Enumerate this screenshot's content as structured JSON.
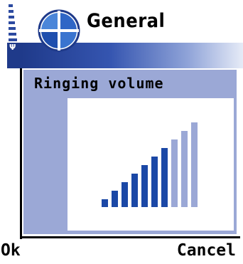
{
  "header": {
    "title": "General",
    "signal_icon": "signal-strength-icon",
    "antenna_glyph": "Ψ",
    "app_icon": "profiles-globe-icon"
  },
  "popup": {
    "heading": "Ringing volume",
    "volume": {
      "level": 7,
      "max": 10
    },
    "colors": {
      "active_bar": "#1b48a6",
      "inactive_bar": "#9ba8d6",
      "background": "#9ba8d6"
    }
  },
  "softkeys": {
    "left": "Ok",
    "right": "Cancel"
  }
}
